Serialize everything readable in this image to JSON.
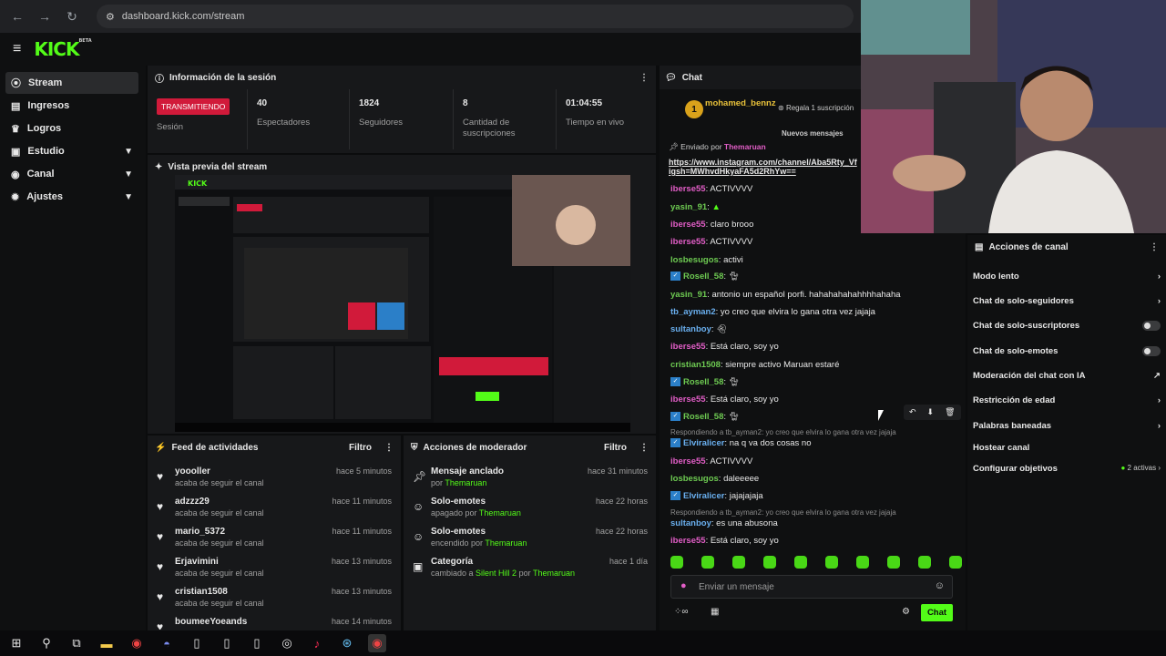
{
  "browser": {
    "url": "dashboard.kick.com/stream"
  },
  "brand": {
    "logo": "KICK",
    "beta": "BETA"
  },
  "sidebar": {
    "items": [
      {
        "label": "Stream",
        "icon": "broadcast-icon"
      },
      {
        "label": "Ingresos",
        "icon": "money-icon"
      },
      {
        "label": "Logros",
        "icon": "trophy-icon"
      },
      {
        "label": "Estudio",
        "icon": "studio-icon"
      },
      {
        "label": "Canal",
        "icon": "channel-icon"
      },
      {
        "label": "Ajustes",
        "icon": "gear-icon"
      }
    ]
  },
  "session": {
    "title": "Información de la sesión",
    "status": "TRANSMITIENDO",
    "status_label": "Sesión",
    "stats": [
      {
        "value": "40",
        "label": "Espectadores"
      },
      {
        "value": "1824",
        "label": "Seguidores"
      },
      {
        "value": "8",
        "label": "Cantidad de suscripciones"
      },
      {
        "value": "01:04:55",
        "label": "Tiempo en vivo"
      }
    ]
  },
  "preview": {
    "title": "Vista previa del stream"
  },
  "activities": {
    "title": "Feed de actividades",
    "filter": "Filtro",
    "items": [
      {
        "name": "yoooller",
        "action": "acaba de seguir el canal",
        "time": "hace 5 minutos"
      },
      {
        "name": "adzzz29",
        "action": "acaba de seguir el canal",
        "time": "hace 11 minutos"
      },
      {
        "name": "mario_5372",
        "action": "acaba de seguir el canal",
        "time": "hace 11 minutos"
      },
      {
        "name": "Erjavimini",
        "action": "acaba de seguir el canal",
        "time": "hace 13 minutos"
      },
      {
        "name": "cristian1508",
        "action": "acaba de seguir el canal",
        "time": "hace 13 minutos"
      },
      {
        "name": "boumeeYoeands",
        "action": "",
        "time": "hace 14 minutos"
      }
    ]
  },
  "mod": {
    "title": "Acciones de moderador",
    "filter": "Filtro",
    "items": [
      {
        "name": "Mensaje anclado",
        "pre": "por",
        "by": "Themaruan",
        "time": "hace 31 minutos"
      },
      {
        "name": "Solo-emotes",
        "pre": "apagado por",
        "by": "Themaruan",
        "time": "hace 22 horas"
      },
      {
        "name": "Solo-emotes",
        "pre": "encendido por",
        "by": "Themaruan",
        "time": "hace 22 horas"
      },
      {
        "name": "Categoría",
        "pre": "cambiado a",
        "by": "Silent Hill 2",
        "pre2": "por",
        "by2": "Themaruan",
        "time": "hace 1 día"
      }
    ]
  },
  "chat": {
    "title": "Chat",
    "top_user": "mohamed_bennz",
    "top_badge": "1",
    "gift_text": "Regala 1 suscripción",
    "new_messages": "Nuevos mensajes",
    "pinned_by_label": "Enviado por",
    "pinned_by": "Themaruan",
    "pinned_link1": "https://www.instagram.com/channel/Aba5Rty_Vf",
    "pinned_link2": "igsh=MWhvdHkyaFA5d2RhYw==",
    "messages": [
      {
        "user": "iberse55",
        "text": "ACTIVVVV",
        "color": "pink"
      },
      {
        "user": "yasin_91",
        "text": "",
        "color": "green"
      },
      {
        "user": "iberse55",
        "text": "claro brooo",
        "color": "pink"
      },
      {
        "user": "iberse55",
        "text": "ACTIVVVV",
        "color": "pink"
      },
      {
        "user": "losbesugos",
        "text": "activi",
        "color": "green"
      },
      {
        "user": "Rosell_58",
        "text": "",
        "color": "green",
        "verified": true
      },
      {
        "user": "yasin_91",
        "text": "antonio un español porfi. hahahahahahhhhahaha",
        "color": "green"
      },
      {
        "user": "tb_ayman2",
        "text": "yo creo que elvira lo gana otra vez jajaja",
        "color": "blue"
      },
      {
        "user": "sultanboy",
        "text": "",
        "color": "blue"
      },
      {
        "user": "iberse55",
        "text": "Está claro, soy yo",
        "color": "pink"
      },
      {
        "user": "cristian1508",
        "text": "siempre activo Maruan estaré",
        "color": "green"
      },
      {
        "user": "Rosell_58",
        "text": "",
        "color": "green",
        "verified": true
      },
      {
        "user": "iberse55",
        "text": "Está claro, soy yo",
        "color": "pink"
      },
      {
        "user": "Rosell_58",
        "text": "",
        "color": "green",
        "verified": true
      },
      {
        "reply": "Respondiendo a tb_ayman2: yo creo que elvira lo gana otra vez jajaja"
      },
      {
        "user": "Elviralicer",
        "text": "na q va dos cosas no",
        "color": "blue",
        "verified": true
      },
      {
        "user": "iberse55",
        "text": "ACTIVVVV",
        "color": "pink"
      },
      {
        "user": "losbesugos",
        "text": "daleeeee",
        "color": "green"
      },
      {
        "user": "Elviralicer",
        "text": "jajajajaja",
        "color": "blue",
        "verified": true
      },
      {
        "reply": "Respondiendo a tb_ayman2: yo creo que elvira lo gana otra vez jajaja"
      },
      {
        "user": "sultanboy",
        "text": "es una abusona",
        "color": "blue"
      },
      {
        "user": "iberse55",
        "text": "Está claro, soy yo",
        "color": "pink"
      }
    ],
    "input_placeholder": "Enviar un mensaje",
    "send_label": "Chat"
  },
  "channel_actions": {
    "title": "Acciones de canal",
    "items": [
      {
        "label": "Modo lento",
        "control": "chevron"
      },
      {
        "label": "Chat de solo-seguidores",
        "control": "chevron"
      },
      {
        "label": "Chat de solo-suscriptores",
        "control": "toggle"
      },
      {
        "label": "Chat de solo-emotes",
        "control": "toggle"
      },
      {
        "label": "Moderación del chat con IA",
        "control": "external"
      },
      {
        "label": "Restricción de edad",
        "control": "chevron"
      },
      {
        "label": "Palabras baneadas",
        "control": "chevron"
      },
      {
        "label": "Hostear canal",
        "control": "none"
      },
      {
        "label": "Configurar objetivos",
        "control": "chevron",
        "extra": "2 activas"
      }
    ]
  },
  "colors": {
    "brand": "#53fc18",
    "live": "#d11a3a",
    "panel": "#17181a",
    "bg": "#0b0c0d"
  }
}
